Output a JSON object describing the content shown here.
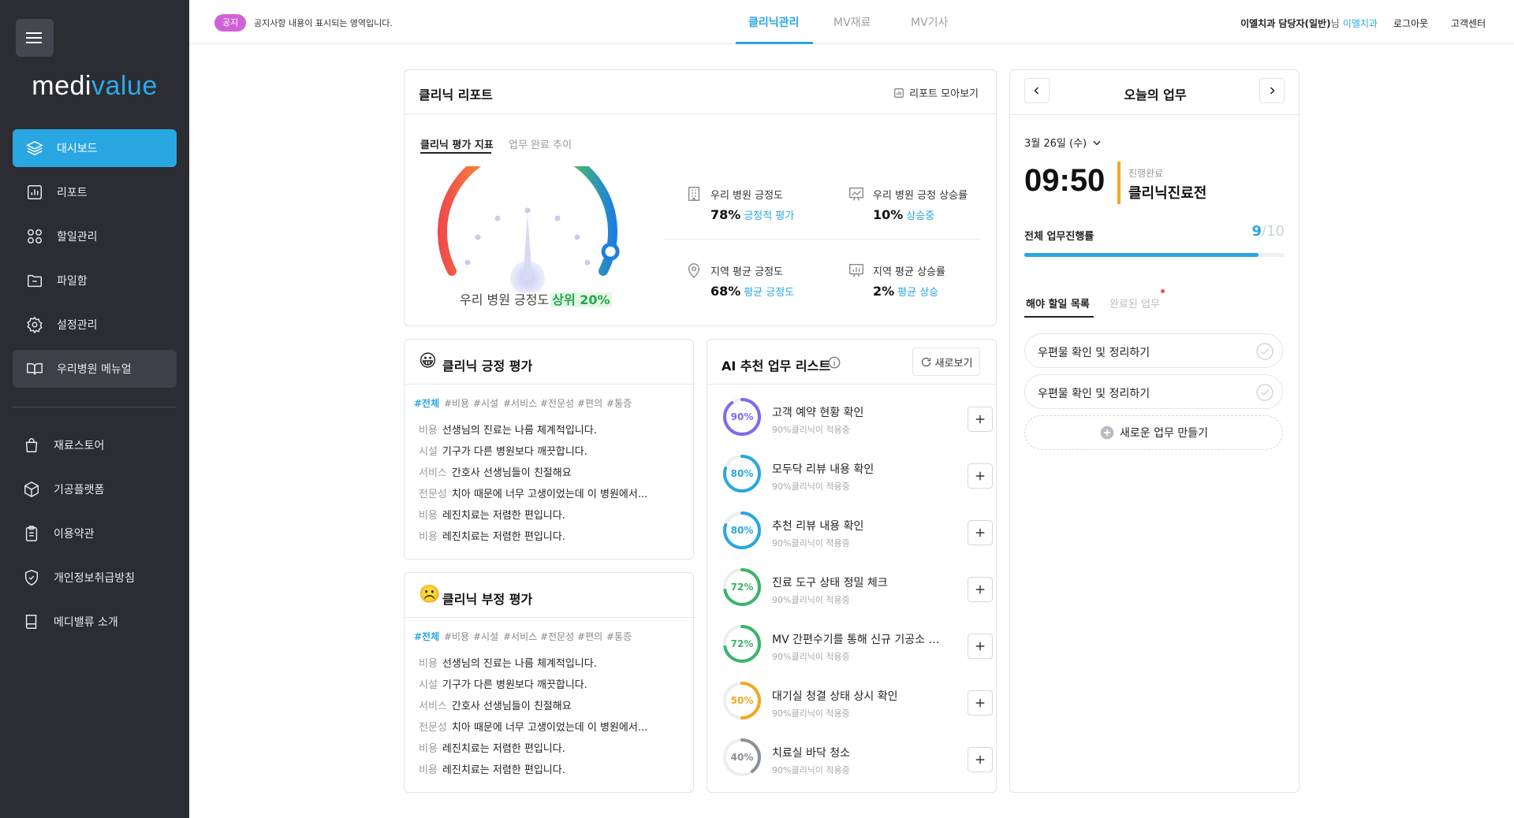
{
  "sidebar": {
    "logo": {
      "part1": "medi",
      "part2": "value"
    },
    "items": [
      {
        "label": "대시보드"
      },
      {
        "label": "리포트"
      },
      {
        "label": "할일관리"
      },
      {
        "label": "파일함"
      },
      {
        "label": "설정관리"
      },
      {
        "label": "우리병원 메뉴얼"
      }
    ],
    "links": [
      {
        "label": "재료스토어"
      },
      {
        "label": "기공플랫폼"
      },
      {
        "label": "이용약관"
      },
      {
        "label": "개인정보취급방침"
      },
      {
        "label": "메디밸류 소개"
      }
    ]
  },
  "topbar": {
    "notice_badge": "공지",
    "notice_text": "공지사항 내용이 표시되는 영역입니다.",
    "tabs": [
      {
        "label": "클리닉관리",
        "active": true
      },
      {
        "label": "MV재료",
        "active": false
      },
      {
        "label": "MV기사",
        "active": false
      }
    ],
    "user": {
      "prefix": "이엘치과 담당자(일반)",
      "suffix": "님",
      "clinic": "이엘치과"
    },
    "logout": "로그아웃",
    "support": "고객센터"
  },
  "report": {
    "title": "클리닉 리포트",
    "collect_label": "리포트 모아보기",
    "tabs": [
      {
        "label": "클리닉 평가 지표"
      },
      {
        "label": "업무 완료 추이"
      }
    ],
    "gauge": {
      "caption": "우리 병원 긍정도",
      "rank": "상위 20%",
      "level": 0.8
    },
    "metrics": [
      {
        "label": "우리 병원 긍정도",
        "value": "78%",
        "note": "긍정적 평가",
        "icon": "building-icon"
      },
      {
        "label": "우리 병원 긍정 상승률",
        "value": "10%",
        "note": "상승중",
        "icon": "trend-board-icon"
      },
      {
        "label": "지역 평균 긍정도",
        "value": "68%",
        "note": "평균 긍정도",
        "icon": "map-pin-icon"
      },
      {
        "label": "지역 평균 상승률",
        "value": "2%",
        "note": "평균 상승",
        "icon": "chart-board-icon"
      }
    ]
  },
  "positive": {
    "title": "클리닉 긍정 평가",
    "tags": [
      "#전체",
      "#비용",
      "#시설",
      "#서비스",
      "#전문성",
      "#편의",
      "#통증"
    ],
    "reviews": [
      {
        "cat": "비용",
        "text": "선생님의 진료는 나름 체계적입니다."
      },
      {
        "cat": "시설",
        "text": "기구가 다른 병원보다 깨끗합니다."
      },
      {
        "cat": "서비스",
        "text": "간호사 선생님들이 친절해요"
      },
      {
        "cat": "전문성",
        "text": "치아 때문에 너무 고생이었는데 이 병원에서..."
      },
      {
        "cat": "비용",
        "text": "레진치료는 저렴한 편입니다."
      },
      {
        "cat": "비용",
        "text": "레진치료는 저렴한 편입니다."
      }
    ]
  },
  "negative": {
    "title": "클리닉 부정 평가",
    "tags": [
      "#전체",
      "#비용",
      "#시설",
      "#서비스",
      "#전문성",
      "#편의",
      "#통증"
    ],
    "reviews": [
      {
        "cat": "비용",
        "text": "선생님의 진료는 나름 체계적입니다."
      },
      {
        "cat": "시설",
        "text": "기구가 다른 병원보다 깨끗합니다."
      },
      {
        "cat": "서비스",
        "text": "간호사 선생님들이 친절해요"
      },
      {
        "cat": "전문성",
        "text": "치아 때문에 너무 고생이었는데 이 병원에서..."
      },
      {
        "cat": "비용",
        "text": "레진치료는 저렴한 편입니다."
      },
      {
        "cat": "비용",
        "text": "레진치료는 저렴한 편입니다."
      }
    ]
  },
  "ai": {
    "title": "AI 추천 업무 리스트",
    "refresh_label": "새로보기",
    "items": [
      {
        "pct": 90,
        "pct_label": "90%",
        "title": "고객 예약 현황 확인",
        "sub": "90%클리닉이 적용중",
        "color": "#7b6cf0"
      },
      {
        "pct": 80,
        "pct_label": "80%",
        "title": "모두닥 리뷰 내용 확인",
        "sub": "90%클리닉이 적용중",
        "color": "#29a7e3"
      },
      {
        "pct": 80,
        "pct_label": "80%",
        "title": "추천 리뷰 내용 확인",
        "sub": "90%클리닉이 적용중",
        "color": "#29a7e3"
      },
      {
        "pct": 72,
        "pct_label": "72%",
        "title": "진료 도구 상태 정밀 체크",
        "sub": "90%클리닉이 적용중",
        "color": "#3bb46b"
      },
      {
        "pct": 72,
        "pct_label": "72%",
        "title": "MV 간편수기를 통해 신규 기공소 매...",
        "sub": "90%클리닉이 적용중",
        "color": "#3bb46b"
      },
      {
        "pct": 50,
        "pct_label": "50%",
        "title": "대기실 청결 상태 상시 확인",
        "sub": "90%클리닉이 적용중",
        "color": "#f5a623"
      },
      {
        "pct": 40,
        "pct_label": "40%",
        "title": "치료실 바닥 청소",
        "sub": "90%클리닉이 적용중",
        "color": "#8a8f98"
      }
    ]
  },
  "today": {
    "title": "오늘의 업무",
    "date": "3월 26일 (수)",
    "time": "09:50",
    "status_small": "진행완료",
    "status_big": "클리닉진료전",
    "progress_label": "전체 업무진행률",
    "done": "9",
    "total": "/10",
    "progress": 0.9,
    "tabs": [
      {
        "label": "해야 할일 목록"
      },
      {
        "label": "완료된 업무"
      }
    ],
    "todos": [
      {
        "text": "우편물 확인 및 정리하기"
      },
      {
        "text": "우편물 확인 및 정리하기"
      }
    ],
    "new_label": "새로운 업무 만들기"
  },
  "colors": {
    "accent": "#29a7e3",
    "sidebar": "#2b2d33",
    "badge": "#d061d8"
  }
}
